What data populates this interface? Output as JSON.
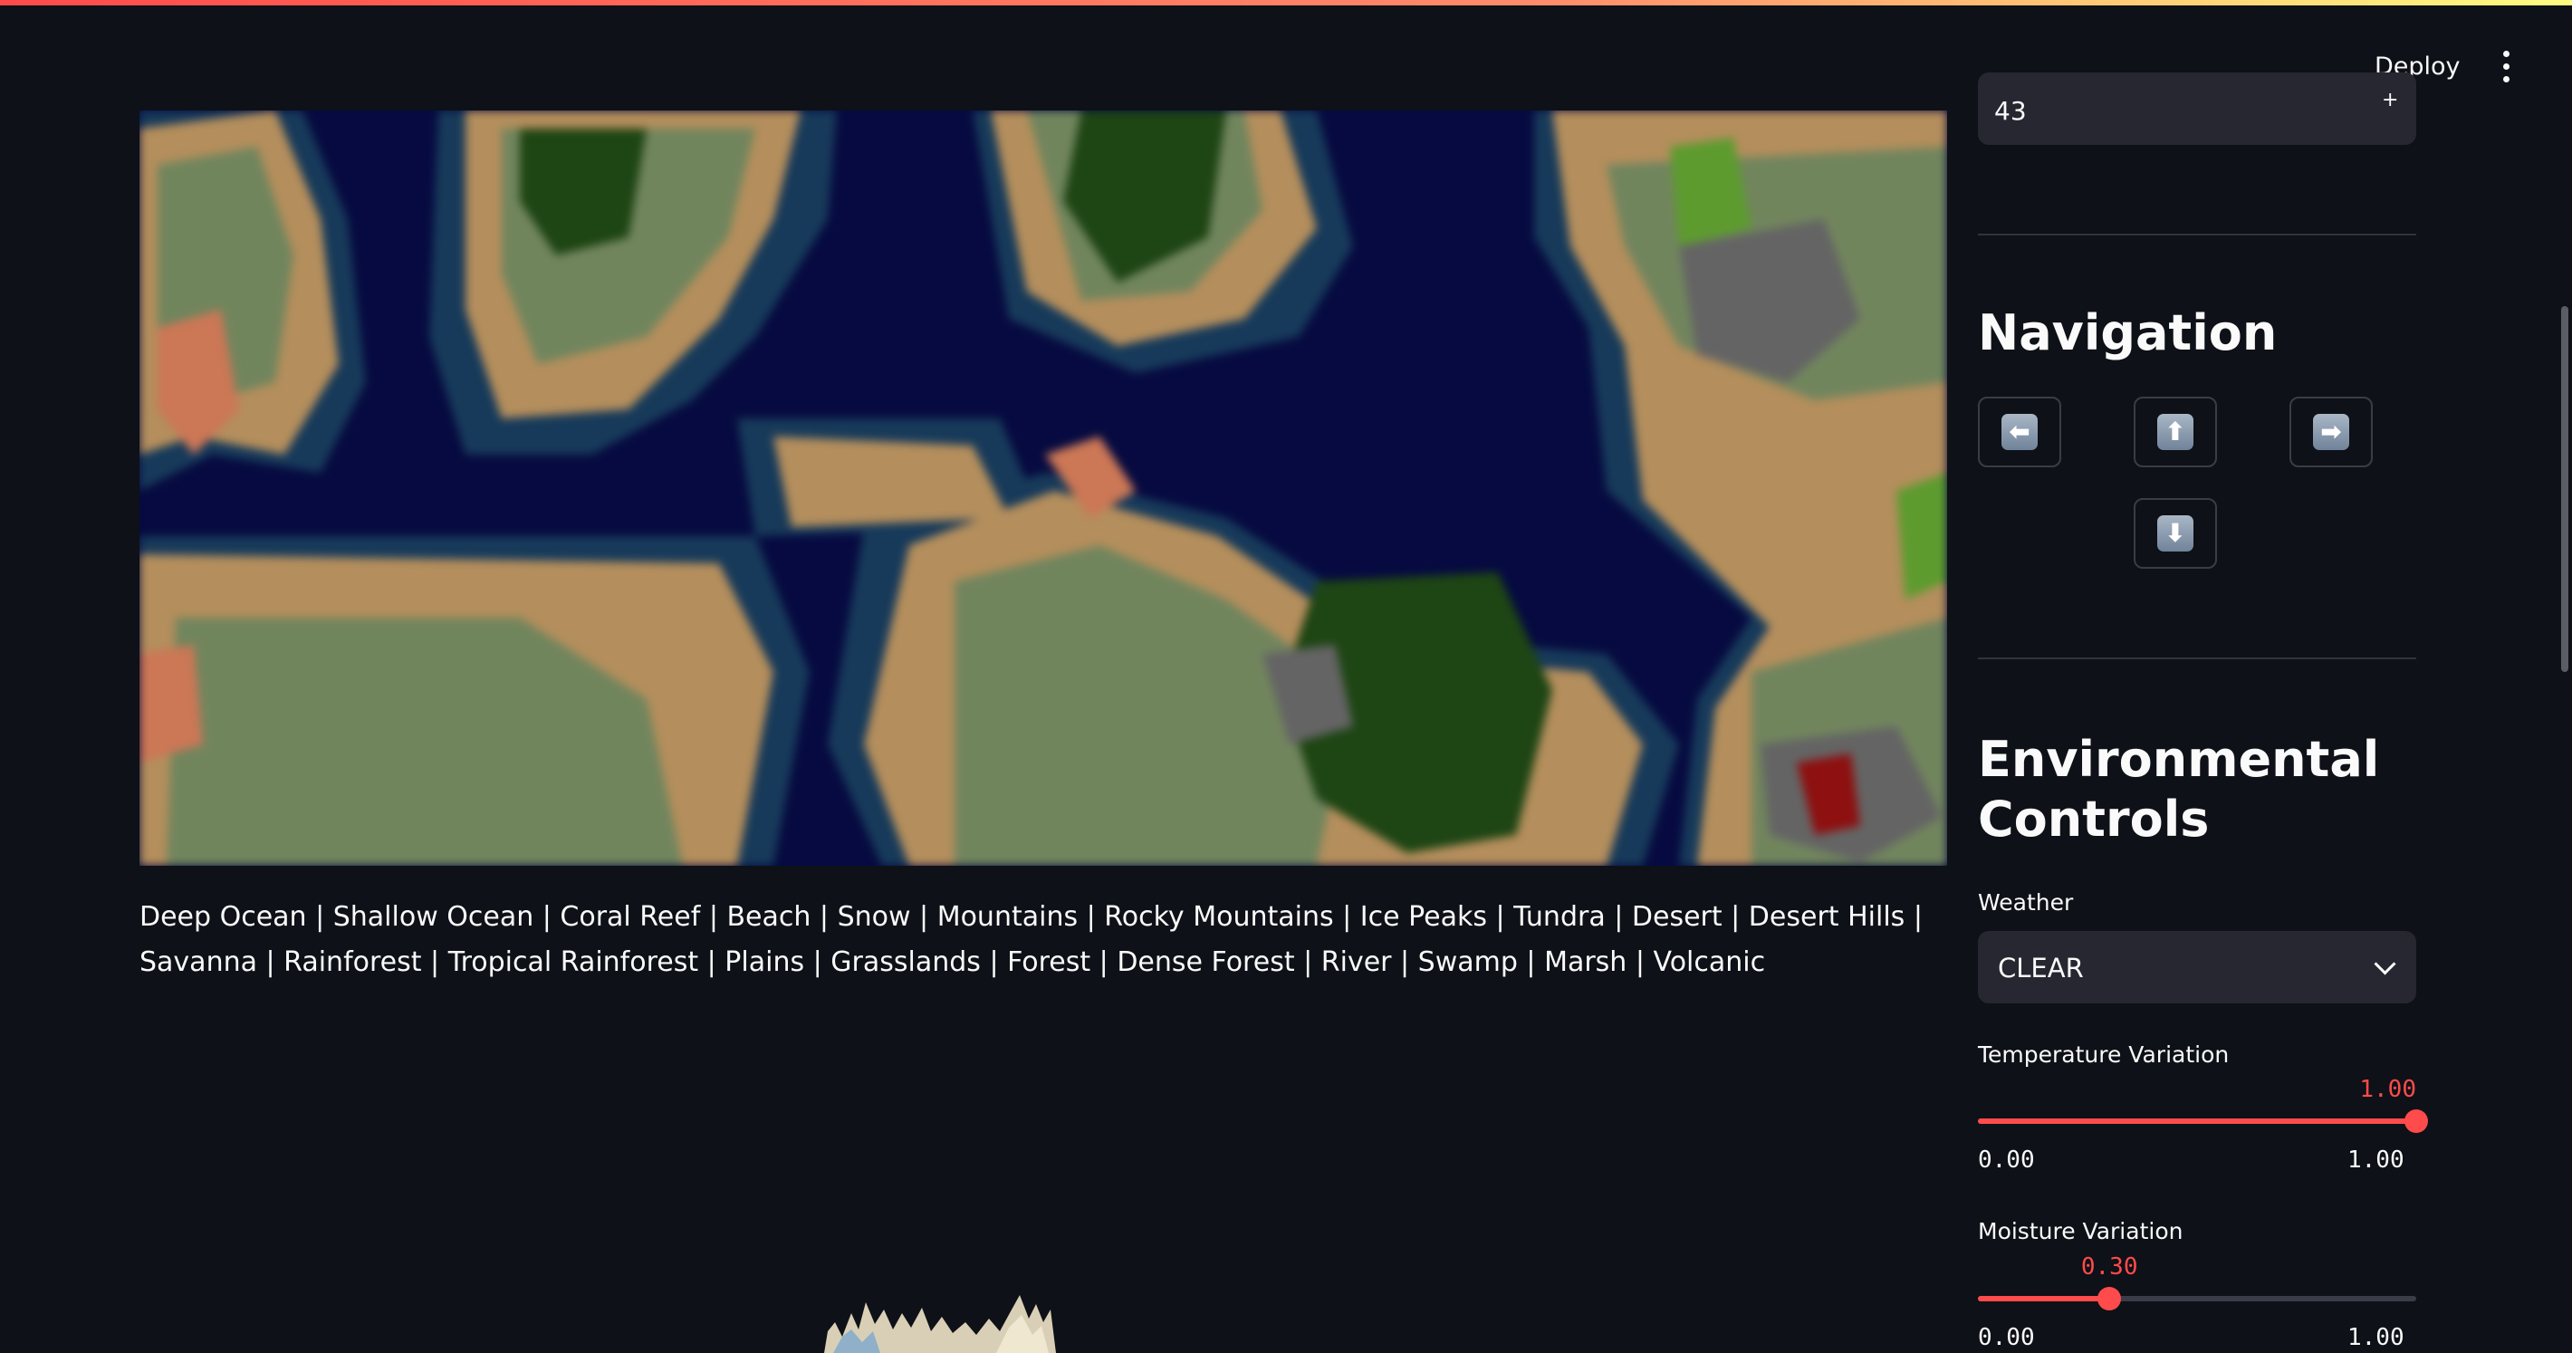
{
  "header": {
    "deploy_label": "Deploy"
  },
  "sidebar": {
    "seed_value": "43",
    "navigation_title": "Navigation",
    "nav_buttons": {
      "left": "⬅",
      "up": "⬆",
      "right": "➡",
      "down": "⬇"
    },
    "environment_title": "Environmental Controls",
    "weather": {
      "label": "Weather",
      "value": "CLEAR"
    },
    "temperature": {
      "label": "Temperature Variation",
      "value": "1.00",
      "fraction": 1.0,
      "min": "0.00",
      "max": "1.00"
    },
    "moisture": {
      "label": "Moisture Variation",
      "value": "0.30",
      "fraction": 0.3,
      "min": "0.00",
      "max": "1.00"
    }
  },
  "main": {
    "legend_text": "Deep Ocean | Shallow Ocean | Coral Reef | Beach | Snow | Mountains | Rocky Mountains | Ice Peaks | Tundra | Desert | Desert Hills | Savanna | Rainforest | Tropical Rainforest | Plains | Grasslands | Forest | Dense Forest | River | Swamp | Marsh | Volcanic"
  },
  "colors": {
    "accent": "#ff4b4b",
    "background": "#0e1117",
    "deep_ocean": "#060a40",
    "shallow_ocean": "#173a5a",
    "beach": "#b48e5c",
    "plains": "#71855d",
    "forest": "#1e4514",
    "mountains": "#646464",
    "volcanic": "#8e1010",
    "coral_reef": "#cc7755"
  }
}
